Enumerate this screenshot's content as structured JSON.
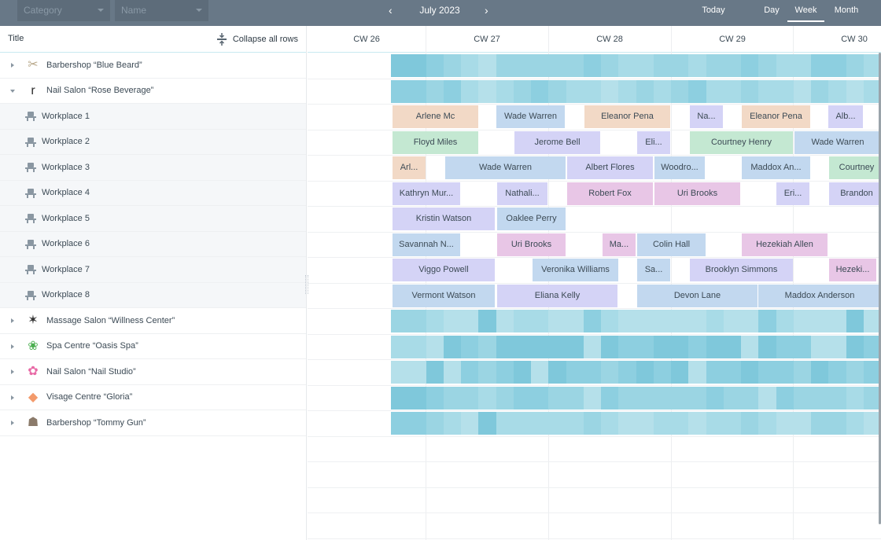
{
  "toolbar": {
    "category_placeholder": "Category",
    "name_placeholder": "Name",
    "prev_label": "‹",
    "next_label": "›",
    "month": "July 2023",
    "today_label": "Today",
    "views": [
      {
        "label": "Day",
        "active": false
      },
      {
        "label": "Week",
        "active": true
      },
      {
        "label": "Month",
        "active": false
      }
    ]
  },
  "left_header": {
    "title": "Title",
    "collapse_label": "Collapse all rows"
  },
  "weeks": [
    "CW 26",
    "CW 27",
    "CW 28",
    "CW 29",
    "CW 30"
  ],
  "rows": [
    {
      "name": "Barbershop “Blue Beard”",
      "type": "group",
      "expanded": false,
      "logo": "barbershop-logo",
      "logo_color": "#b8a88a"
    },
    {
      "name": "Nail Salon “Rose Beverage”",
      "type": "group",
      "expanded": true,
      "logo": "rose-logo",
      "logo_color": "#2c2c2c"
    },
    {
      "name": "Workplace 1",
      "type": "child"
    },
    {
      "name": "Workplace 2",
      "type": "child"
    },
    {
      "name": "Workplace 3",
      "type": "child"
    },
    {
      "name": "Workplace 4",
      "type": "child"
    },
    {
      "name": "Workplace 5",
      "type": "child"
    },
    {
      "name": "Workplace 6",
      "type": "child"
    },
    {
      "name": "Workplace 7",
      "type": "child"
    },
    {
      "name": "Workplace 8",
      "type": "child"
    },
    {
      "name": "Massage Salon “Willness Center”",
      "type": "group",
      "expanded": false,
      "logo": "massage-logo",
      "logo_color": "#333333"
    },
    {
      "name": "Spa Centre “Oasis Spa”",
      "type": "group",
      "expanded": false,
      "logo": "spa-logo",
      "logo_color": "#4caf50"
    },
    {
      "name": "Nail Salon “Nail Studio”",
      "type": "group",
      "expanded": false,
      "logo": "nail-studio-logo",
      "logo_color": "#e86aa6"
    },
    {
      "name": "Visage Centre “Gloria”",
      "type": "group",
      "expanded": false,
      "logo": "gloria-logo",
      "logo_color": "#f39a6b"
    },
    {
      "name": "Barbershop “Tommy Gun”",
      "type": "group",
      "expanded": false,
      "logo": "tommy-gun-logo",
      "logo_color": "#8b7a6a"
    }
  ],
  "event_colors": {
    "peach": "#f2d9c6",
    "blue": "#c2d8ef",
    "lavender": "#d4d3f6",
    "green": "#c4e8d2",
    "pink": "#e8c6e6"
  },
  "events": [
    [
      {
        "label": "Arlene Mc",
        "color": "peach"
      },
      {
        "label": "Wade Warren",
        "color": "blue"
      },
      {
        "label": "Eleanor Pena",
        "color": "peach"
      },
      {
        "label": "Na...",
        "color": "lavender"
      },
      {
        "label": "Eleanor Pena",
        "color": "peach"
      },
      {
        "label": "Alb...",
        "color": "lavender"
      }
    ],
    [
      {
        "label": "Floyd Miles",
        "color": "green"
      },
      {
        "label": "Jerome Bell",
        "color": "lavender"
      },
      {
        "label": "Eli...",
        "color": "lavender"
      },
      {
        "label": "Courtney Henry",
        "color": "green"
      },
      {
        "label": "Wade Warren",
        "color": "blue"
      }
    ],
    [
      {
        "label": "Arl...",
        "color": "peach"
      },
      {
        "label": "Wade Warren",
        "color": "blue"
      },
      {
        "label": "Albert Flores",
        "color": "lavender"
      },
      {
        "label": "Woodro...",
        "color": "blue"
      },
      {
        "label": "Maddox An...",
        "color": "blue"
      },
      {
        "label": "Courtney",
        "color": "green"
      }
    ],
    [
      {
        "label": "Kathryn Mur...",
        "color": "lavender"
      },
      {
        "label": "Nathali...",
        "color": "lavender"
      },
      {
        "label": "Robert Fox",
        "color": "pink"
      },
      {
        "label": "Uri Brooks",
        "color": "pink"
      },
      {
        "label": "Eri...",
        "color": "lavender"
      },
      {
        "label": "Brandon",
        "color": "lavender"
      }
    ],
    [
      {
        "label": "Kristin Watson",
        "color": "lavender"
      },
      {
        "label": "Oaklee Perry",
        "color": "blue"
      }
    ],
    [
      {
        "label": "Savannah N...",
        "color": "blue"
      },
      {
        "label": "Uri Brooks",
        "color": "pink"
      },
      {
        "label": "Ma...",
        "color": "pink"
      },
      {
        "label": "Colin Hall",
        "color": "blue"
      },
      {
        "label": "Hezekiah Allen",
        "color": "pink"
      }
    ],
    [
      {
        "label": "Viggo Powell",
        "color": "lavender"
      },
      {
        "label": "Veronika Williams",
        "color": "blue"
      },
      {
        "label": "Sa...",
        "color": "blue"
      },
      {
        "label": "Brooklyn Simmons",
        "color": "lavender"
      },
      {
        "label": "Hezeki...",
        "color": "pink"
      }
    ],
    [
      {
        "label": "Vermont Watson",
        "color": "blue"
      },
      {
        "label": "Eliana Kelly",
        "color": "lavender"
      },
      {
        "label": "Devon Lane",
        "color": "blue"
      },
      {
        "label": "Maddox Anderson",
        "color": "blue"
      }
    ]
  ],
  "heat_palette": [
    "#7fc8db",
    "#8dcfe0",
    "#9bd5e3",
    "#a8dbe7",
    "#b5e0ea"
  ]
}
